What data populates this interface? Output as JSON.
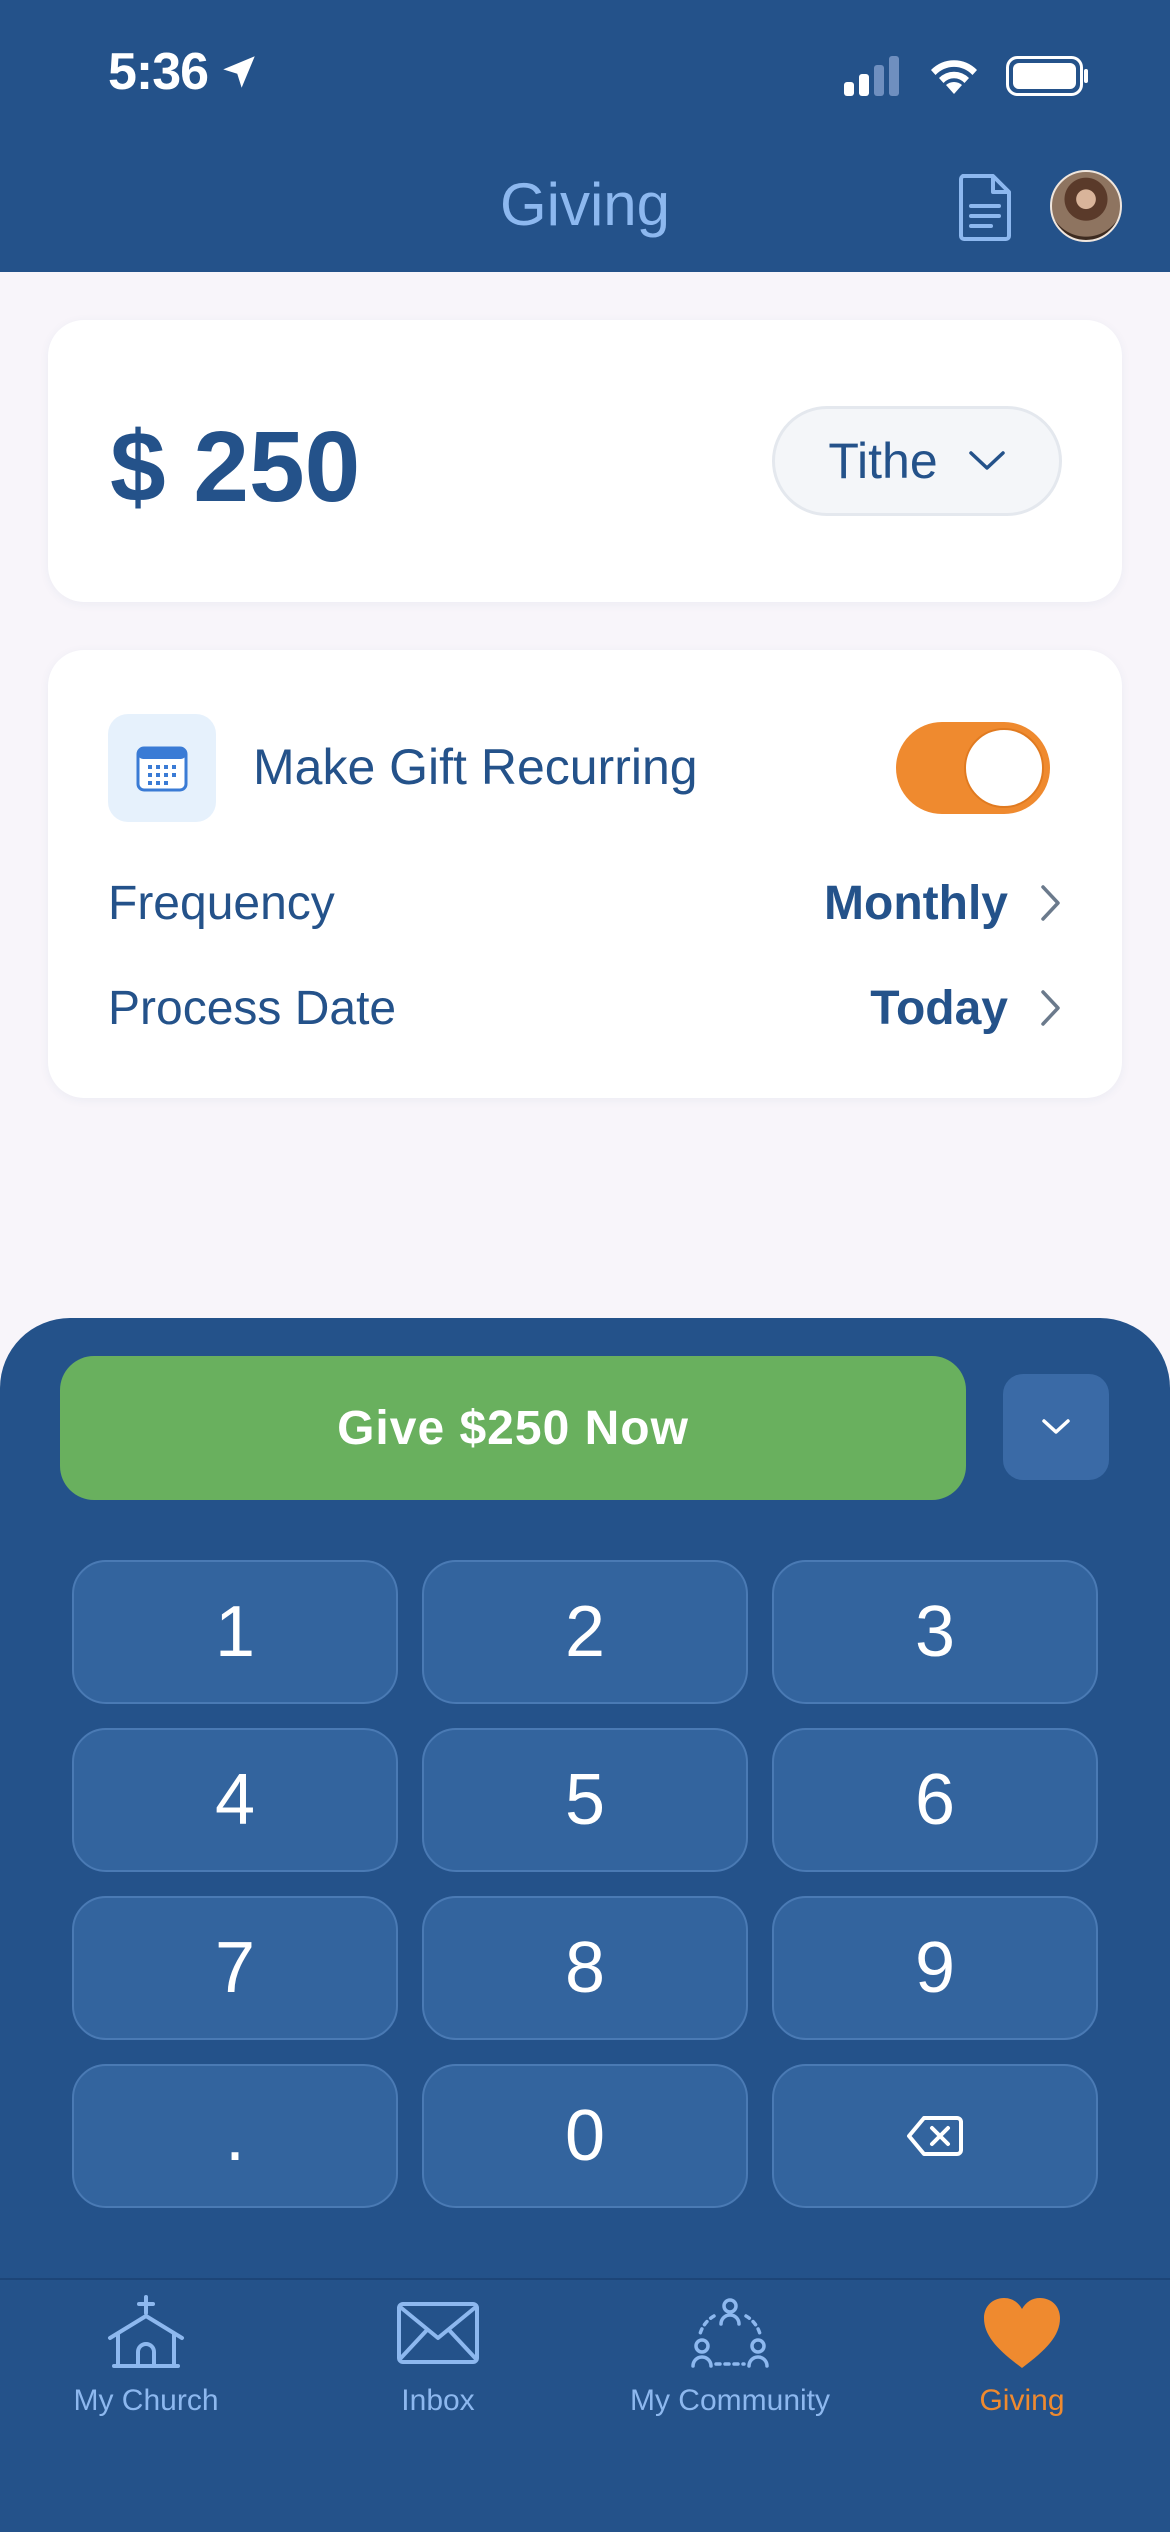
{
  "status_bar": {
    "time": "5:36"
  },
  "header": {
    "title": "Giving"
  },
  "gift": {
    "currency": "$",
    "amount": "250",
    "fund": "Tithe"
  },
  "recurring": {
    "label": "Make Gift Recurring",
    "enabled": true,
    "frequency_label": "Frequency",
    "frequency_value": "Monthly",
    "process_date_label": "Process Date",
    "process_date_value": "Today"
  },
  "keypad": {
    "give_button_label": "Give $250 Now",
    "keys": [
      "1",
      "2",
      "3",
      "4",
      "5",
      "6",
      "7",
      "8",
      "9",
      ".",
      "0"
    ]
  },
  "tabbar": {
    "items": [
      {
        "label": "My Church",
        "icon": "church-icon"
      },
      {
        "label": "Inbox",
        "icon": "envelope-icon"
      },
      {
        "label": "My Community",
        "icon": "community-icon"
      },
      {
        "label": "Giving",
        "icon": "heart-icon",
        "active": true
      }
    ]
  },
  "colors": {
    "primary": "#24528a",
    "accent": "#ef8a2f",
    "give_button": "#69b05e"
  }
}
